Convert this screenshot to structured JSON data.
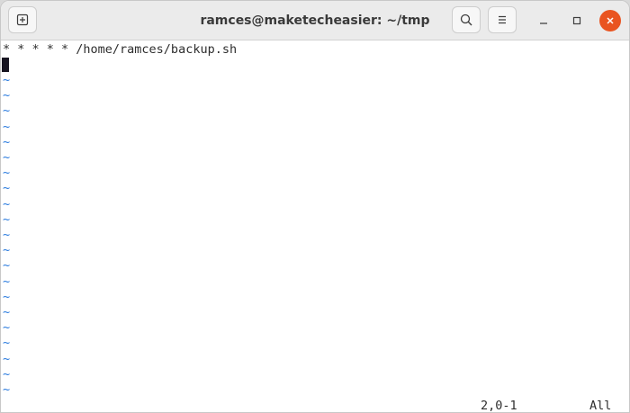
{
  "window": {
    "title": "ramces@maketecheasier: ~/tmp",
    "close_color": "#e95420"
  },
  "toolbar": {
    "new_tab_icon": "new-tab-icon",
    "search_icon": "search-icon",
    "menu_icon": "hamburger-menu-icon"
  },
  "editor": {
    "lines": [
      "* * * * * /home/ramces/backup.sh"
    ],
    "empty_line_marker": "~",
    "empty_line_count": 21,
    "empty_line_color": "#2a7bde",
    "status": {
      "position": "2,0-1",
      "scroll": "All"
    }
  }
}
